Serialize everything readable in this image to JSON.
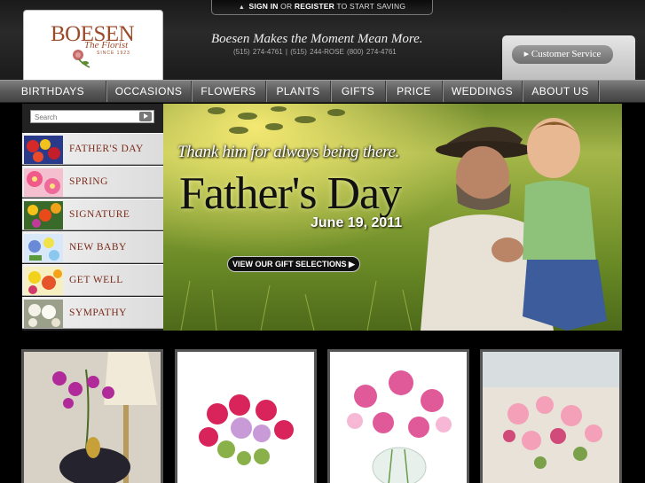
{
  "header": {
    "signin": {
      "sign_in": "SIGN IN",
      "or": "OR",
      "register": "REGISTER",
      "rest": "TO START SAVING"
    },
    "logo": {
      "name": "BOESEN",
      "sub": "The Florist",
      "since": "SINCE 1923"
    },
    "tagline": "Boesen Makes the Moment Mean More.",
    "phones": "(515) 274-4761  |  (515) 244-ROSE (800) 274-4761",
    "customer_service": "Customer Service"
  },
  "nav": {
    "items": [
      {
        "label": "BIRTHDAYS"
      },
      {
        "label": "OCCASIONS"
      },
      {
        "label": "FLOWERS"
      },
      {
        "label": "PLANTS"
      },
      {
        "label": "GIFTS"
      },
      {
        "label": "PRICE"
      },
      {
        "label": "WEDDINGS"
      },
      {
        "label": "ABOUT US"
      }
    ]
  },
  "sidebar": {
    "search": {
      "placeholder": "Search"
    },
    "categories": [
      {
        "label": "FATHER'S DAY"
      },
      {
        "label": "SPRING"
      },
      {
        "label": "SIGNATURE"
      },
      {
        "label": "NEW BABY"
      },
      {
        "label": "GET WELL"
      },
      {
        "label": "SYMPATHY"
      }
    ]
  },
  "hero": {
    "subtitle": "Thank him for always being there.",
    "title": "Father's Day",
    "date": "June 19, 2011",
    "cta": "VIEW OUR GIFT SELECTIONS"
  },
  "colors": {
    "brand": "#9b4a2a",
    "category_text": "#7a2b1a",
    "nav_bg": "#5a5a5a"
  }
}
